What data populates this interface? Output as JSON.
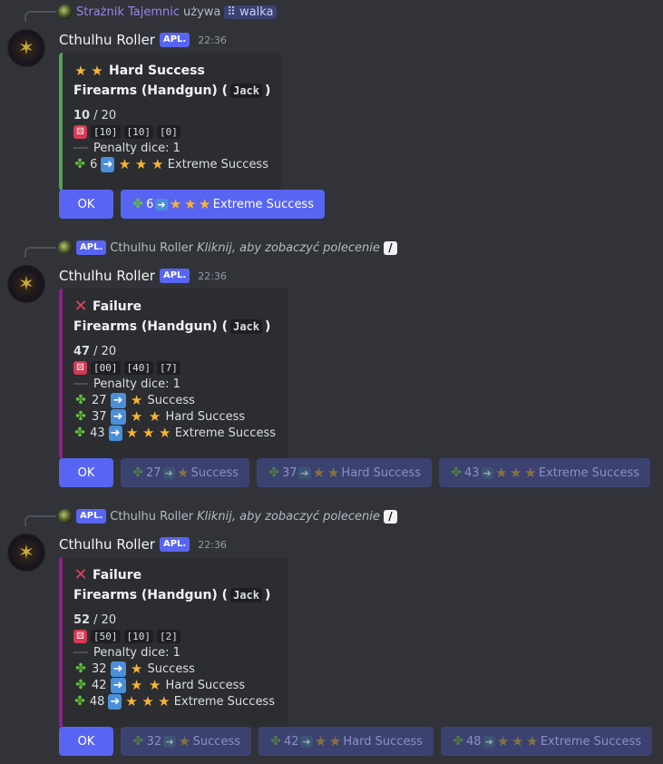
{
  "messages": [
    {
      "reply": {
        "user": "Strażnik Tajemnic",
        "verb": "używa",
        "command": "walka"
      },
      "author": "Cthulhu Roller",
      "app_tag": "APL.",
      "time": "22:36",
      "embed": {
        "title": "Hard Success",
        "skill": "Firearms (Handgun) (",
        "character": "Jack",
        "skill_close": ")",
        "roll": "10",
        "target": "/ 20",
        "dice": [
          "[10]",
          "[10]",
          "[0]"
        ],
        "penalty": "Penalty dice: 1",
        "alternatives": [
          {
            "value": "6",
            "result": "Extreme Success"
          }
        ]
      },
      "buttons": {
        "ok": "OK",
        "alternatives": [
          {
            "value": "6",
            "result": "Extreme Success"
          }
        ]
      }
    },
    {
      "reply": {
        "app_tag": "APL.",
        "user": "Cthulhu Roller",
        "command_hint": "Kliknij, aby zobaczyć polecenie"
      },
      "author": "Cthulhu Roller",
      "app_tag": "APL.",
      "time": "22:36",
      "embed": {
        "title": "Failure",
        "skill": "Firearms (Handgun) (",
        "character": "Jack",
        "skill_close": ")",
        "roll": "47",
        "target": "/ 20",
        "dice": [
          "[00]",
          "[40]",
          "[7]"
        ],
        "penalty": "Penalty dice: 1",
        "alternatives": [
          {
            "value": "27",
            "result": "Success"
          },
          {
            "value": "37",
            "result": "Hard Success"
          },
          {
            "value": "43",
            "result": "Extreme Success"
          }
        ]
      },
      "buttons": {
        "ok": "OK",
        "alternatives": [
          {
            "value": "27",
            "result": "Success"
          },
          {
            "value": "37",
            "result": "Hard Success"
          },
          {
            "value": "43",
            "result": "Extreme Success"
          }
        ]
      }
    },
    {
      "reply": {
        "app_tag": "APL.",
        "user": "Cthulhu Roller",
        "command_hint": "Kliknij, aby zobaczyć polecenie"
      },
      "author": "Cthulhu Roller",
      "app_tag": "APL.",
      "time": "22:36",
      "embed": {
        "title": "Failure",
        "skill": "Firearms (Handgun) (",
        "character": "Jack",
        "skill_close": ")",
        "roll": "52",
        "target": "/ 20",
        "dice": [
          "[50]",
          "[10]",
          "[2]"
        ],
        "penalty": "Penalty dice: 1",
        "alternatives": [
          {
            "value": "32",
            "result": "Success"
          },
          {
            "value": "42",
            "result": "Hard Success"
          },
          {
            "value": "48",
            "result": "Extreme Success"
          }
        ]
      },
      "buttons": {
        "ok": "OK",
        "alternatives": [
          {
            "value": "32",
            "result": "Success"
          },
          {
            "value": "42",
            "result": "Hard Success"
          },
          {
            "value": "48",
            "result": "Extreme Success"
          }
        ]
      }
    }
  ],
  "colors": {
    "success_border": "#57a05a",
    "failure_border": "#8e1f8f",
    "blurple": "#5865f2"
  },
  "icons": {
    "success": "two-stars",
    "failure": "cross-mark",
    "dice": "red-die",
    "alt": "four-leaf-clover",
    "arrow": "right-arrow-box"
  }
}
